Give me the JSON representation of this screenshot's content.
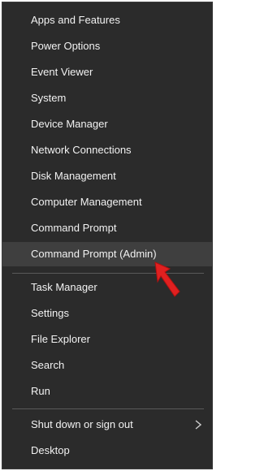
{
  "menu": {
    "groups": [
      {
        "items": [
          {
            "label": "Apps and Features"
          },
          {
            "label": "Power Options"
          },
          {
            "label": "Event Viewer"
          },
          {
            "label": "System"
          },
          {
            "label": "Device Manager"
          },
          {
            "label": "Network Connections"
          },
          {
            "label": "Disk Management"
          },
          {
            "label": "Computer Management"
          },
          {
            "label": "Command Prompt"
          },
          {
            "label": "Command Prompt (Admin)",
            "highlighted": true
          }
        ]
      },
      {
        "items": [
          {
            "label": "Task Manager"
          },
          {
            "label": "Settings"
          },
          {
            "label": "File Explorer"
          },
          {
            "label": "Search"
          },
          {
            "label": "Run"
          }
        ]
      },
      {
        "items": [
          {
            "label": "Shut down or sign out",
            "submenu_icon": "chevron-right-icon"
          },
          {
            "label": "Desktop"
          }
        ]
      }
    ]
  },
  "colors": {
    "menu_background": "#2b2b2b",
    "highlight_background": "#3f3f3f",
    "text": "#f2f2f2",
    "separator": "#5a5a5a",
    "annotation_arrow": "#e02020"
  },
  "annotation": {
    "icon": "red-pointer-arrow-icon"
  }
}
